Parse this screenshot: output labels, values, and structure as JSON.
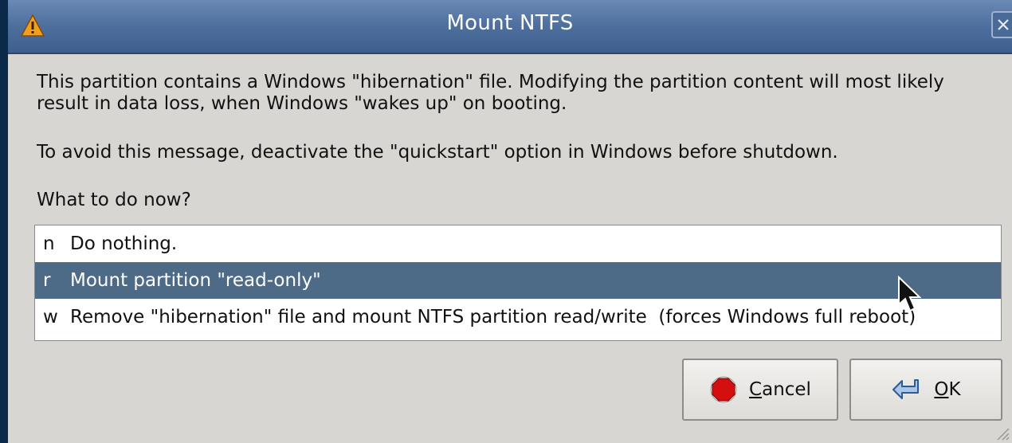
{
  "window": {
    "title": "Mount NTFS",
    "title_icon": "warning-icon",
    "close_icon": "close-icon"
  },
  "message": {
    "line1": "This partition contains a Windows \"hibernation\" file. Modifying the partition content will most likely result in data loss, when Windows \"wakes up\" on booting.",
    "line2": "To avoid this message, deactivate the \"quickstart\" option in Windows before shutdown.",
    "question": "What to do now?"
  },
  "options": [
    {
      "key": "n",
      "label": "Do nothing.",
      "selected": false
    },
    {
      "key": "r",
      "label": "Mount partition \"read-only\"",
      "selected": true
    },
    {
      "key": "w",
      "label": "Remove \"hibernation\" file and mount NTFS partition read/write  (forces Windows full reboot)",
      "selected": false
    }
  ],
  "buttons": {
    "cancel": {
      "accel": "C",
      "rest": "ancel",
      "icon": "stop-icon"
    },
    "ok": {
      "accel": "O",
      "rest": "K",
      "icon": "enter-arrow-icon"
    }
  },
  "colors": {
    "titlebar": "#4d6f9e",
    "selection": "#4d6a86",
    "dialog_bg": "#d8d6d2"
  }
}
